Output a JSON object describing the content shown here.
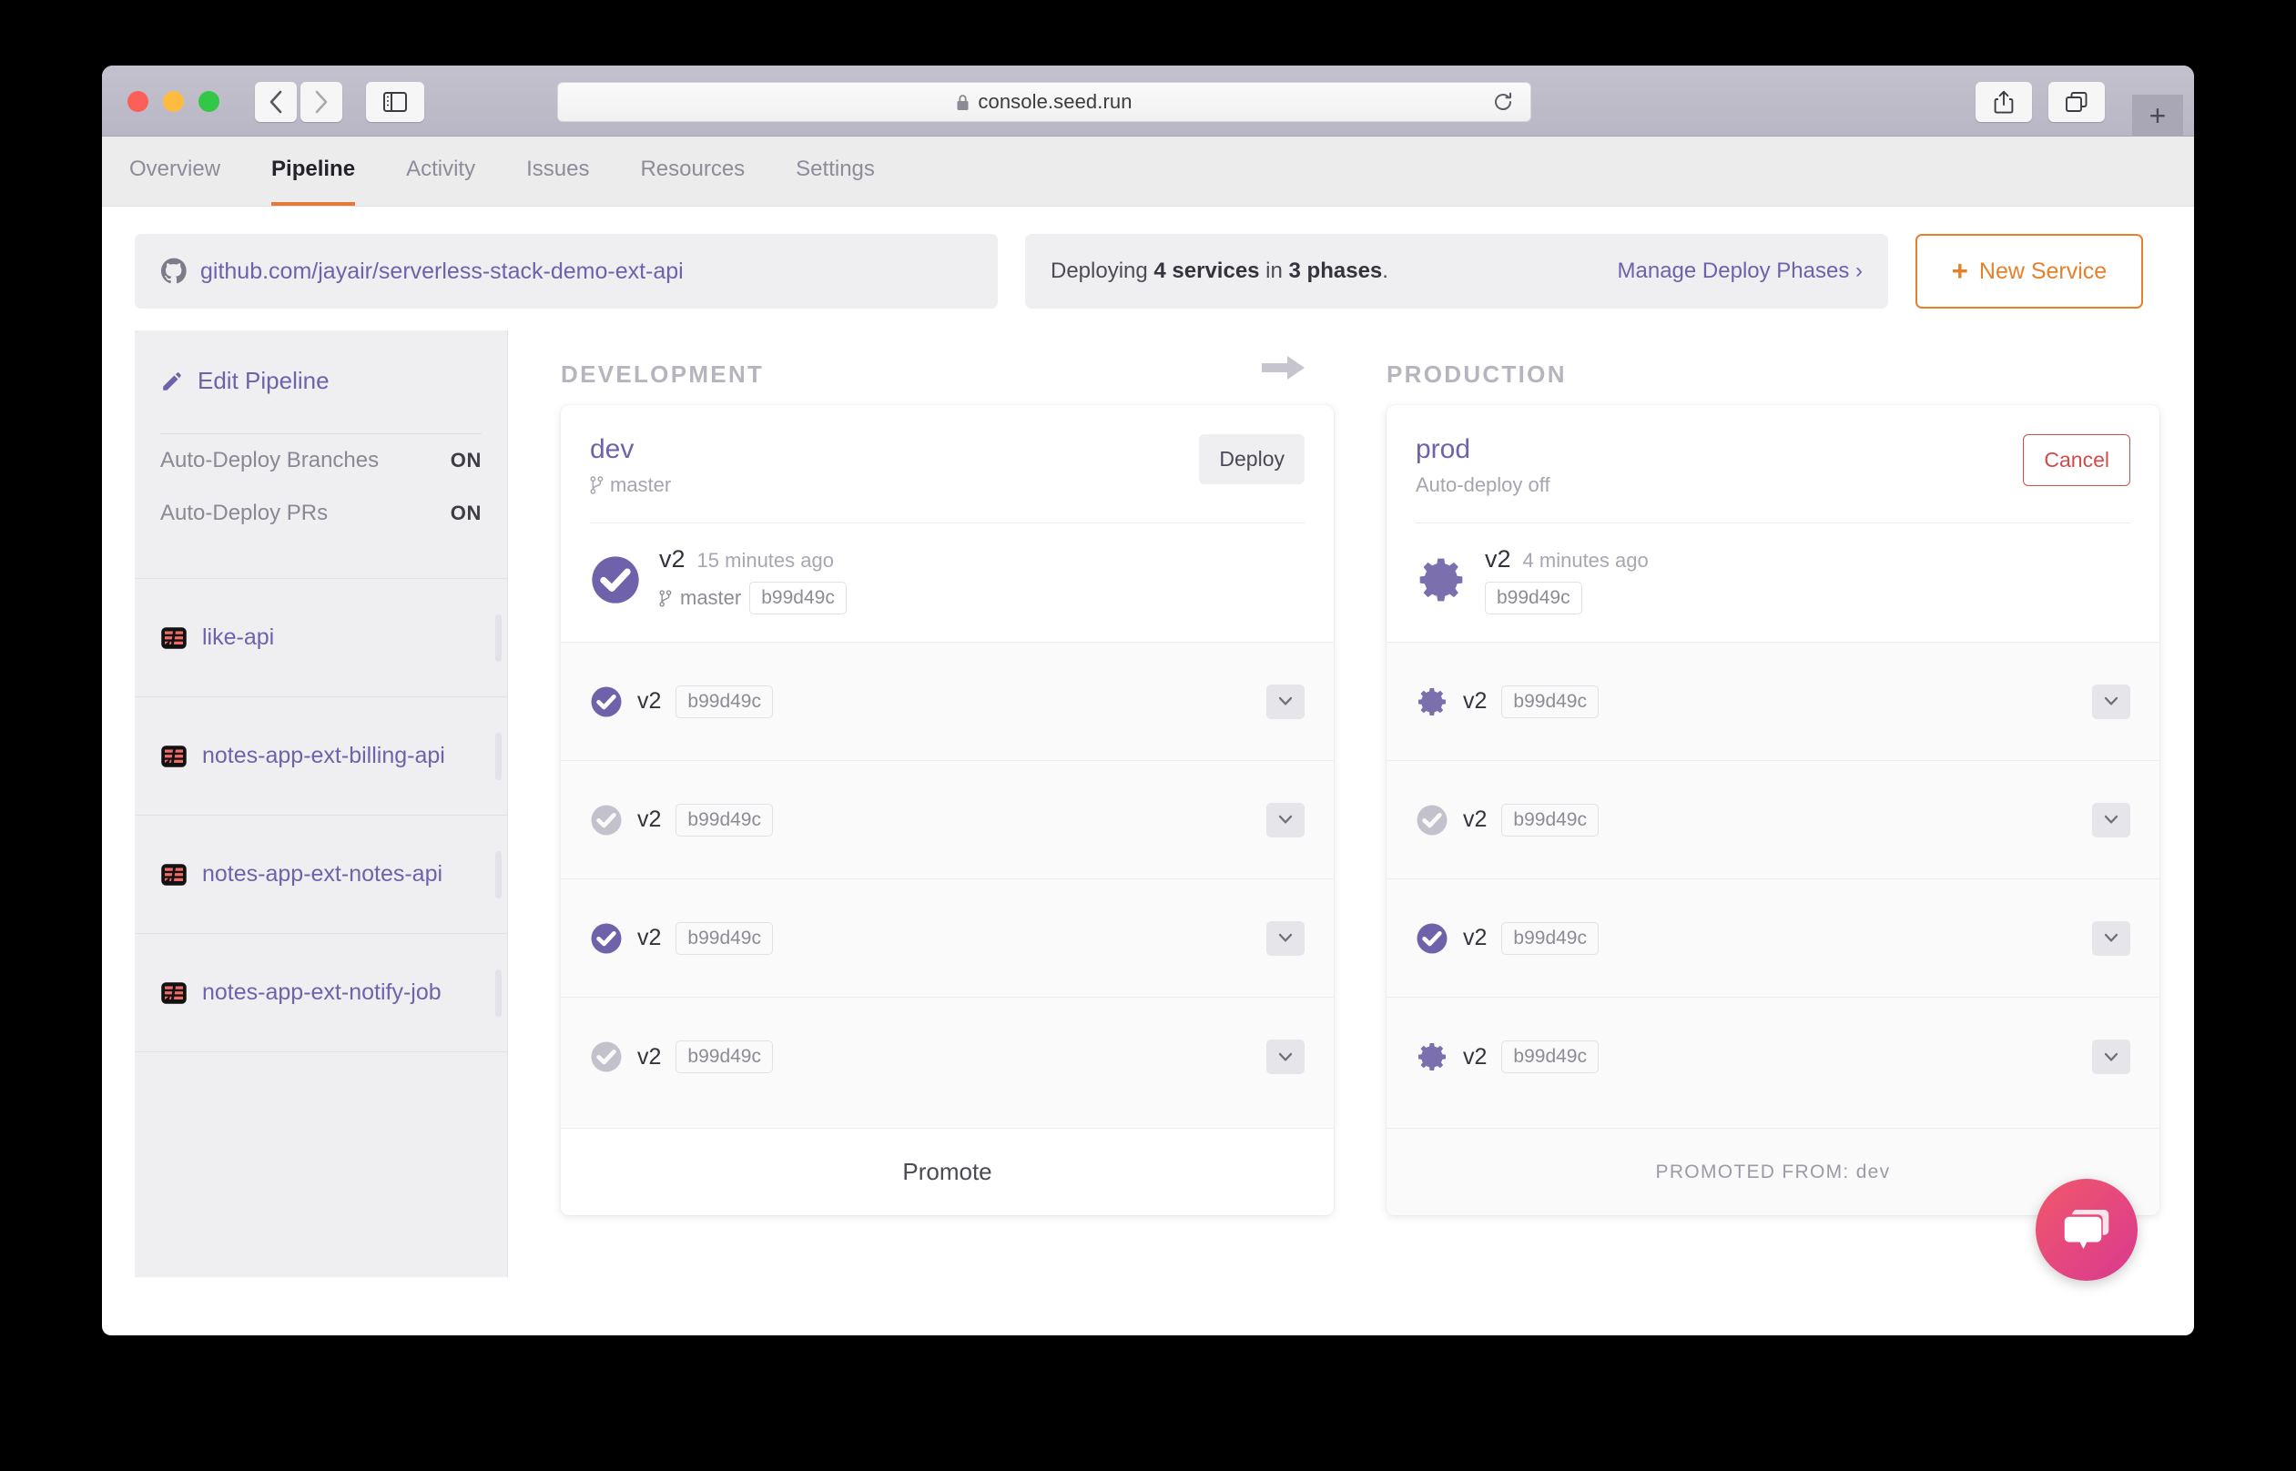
{
  "browser": {
    "url": "console.seed.run",
    "lock_icon": "lock-icon",
    "back_icon": "chevron-left-icon",
    "forward_icon": "chevron-right-icon",
    "sidebar_icon": "sidebar-toggle-icon",
    "reload_icon": "reload-icon",
    "share_icon": "share-icon",
    "tabs_icon": "tab-overview-icon",
    "newtab_icon": "plus-icon"
  },
  "nav": {
    "tabs": [
      {
        "label": "Overview",
        "active": false
      },
      {
        "label": "Pipeline",
        "active": true
      },
      {
        "label": "Activity",
        "active": false
      },
      {
        "label": "Issues",
        "active": false
      },
      {
        "label": "Resources",
        "active": false
      },
      {
        "label": "Settings",
        "active": false
      }
    ]
  },
  "topbar": {
    "repo_icon": "github-icon",
    "repo": "github.com/jayair/serverless-stack-demo-ext-api",
    "deploy_prefix": "Deploying ",
    "deploy_services": "4 services",
    "deploy_middle": " in ",
    "deploy_phases": "3 phases",
    "deploy_suffix": ".",
    "manage_phases": "Manage Deploy Phases ›",
    "new_service": "New Service",
    "new_service_plus": "+",
    "accent_orange": "#e5812a"
  },
  "sidebar": {
    "edit_pipeline": "Edit Pipeline",
    "edit_icon": "pencil-icon",
    "toggles": [
      {
        "label": "Auto-Deploy Branches",
        "state": "ON"
      },
      {
        "label": "Auto-Deploy PRs",
        "state": "ON"
      }
    ],
    "services": [
      {
        "label": "like-api",
        "icon": "service-stack-icon"
      },
      {
        "label": "notes-app-ext-billing-api",
        "icon": "service-stack-icon"
      },
      {
        "label": "notes-app-ext-notes-api",
        "icon": "service-stack-icon"
      },
      {
        "label": "notes-app-ext-notify-job",
        "icon": "service-stack-icon"
      }
    ]
  },
  "pipeline": {
    "arrow_icon": "arrow-right-icon",
    "columns": [
      {
        "heading": "DEVELOPMENT",
        "stage_name": "dev",
        "stage_sub": "master",
        "stage_sub_icon": "git-branch-icon",
        "action_label": "Deploy",
        "action_kind": "deploy",
        "summary": {
          "status_icon": "check-circle-icon",
          "status": "success",
          "version": "v2",
          "ago": "15 minutes ago",
          "branch_icon": "git-branch-icon",
          "branch": "master",
          "commit": "b99d49c"
        },
        "builds": [
          {
            "status_icon": "check-circle-icon",
            "status": "success",
            "version": "v2",
            "commit": "b99d49c",
            "chevron_icon": "chevron-down-icon"
          },
          {
            "status_icon": "check-circle-icon",
            "status": "inactive",
            "version": "v2",
            "commit": "b99d49c",
            "chevron_icon": "chevron-down-icon"
          },
          {
            "status_icon": "check-circle-icon",
            "status": "success",
            "version": "v2",
            "commit": "b99d49c",
            "chevron_icon": "chevron-down-icon"
          },
          {
            "status_icon": "check-circle-icon",
            "status": "inactive",
            "version": "v2",
            "commit": "b99d49c",
            "chevron_icon": "chevron-down-icon"
          }
        ],
        "footer": "Promote",
        "footer_kind": "button"
      },
      {
        "heading": "PRODUCTION",
        "stage_name": "prod",
        "stage_sub": "Auto-deploy off",
        "stage_sub_icon": "",
        "action_label": "Cancel",
        "action_kind": "cancel",
        "summary": {
          "status_icon": "gear-icon",
          "status": "building",
          "version": "v2",
          "ago": "4 minutes ago",
          "branch_icon": "",
          "branch": "",
          "commit": "b99d49c"
        },
        "builds": [
          {
            "status_icon": "gear-icon",
            "status": "building",
            "version": "v2",
            "commit": "b99d49c",
            "chevron_icon": "chevron-down-icon"
          },
          {
            "status_icon": "check-circle-icon",
            "status": "inactive",
            "version": "v2",
            "commit": "b99d49c",
            "chevron_icon": "chevron-down-icon"
          },
          {
            "status_icon": "check-circle-icon",
            "status": "success",
            "version": "v2",
            "commit": "b99d49c",
            "chevron_icon": "chevron-down-icon"
          },
          {
            "status_icon": "gear-icon",
            "status": "building",
            "version": "v2",
            "commit": "b99d49c",
            "chevron_icon": "chevron-down-icon"
          }
        ],
        "footer": "PROMOTED FROM: dev",
        "footer_kind": "note"
      }
    ]
  },
  "chat": {
    "icon": "chat-bubble-icon",
    "color": "#e34c7c"
  },
  "colors": {
    "purple": "#6f62ab",
    "status_success": "#6f62ab",
    "status_inactive": "#c3c1cb",
    "status_building": "#7b6fae",
    "red": "#d64a4a"
  }
}
